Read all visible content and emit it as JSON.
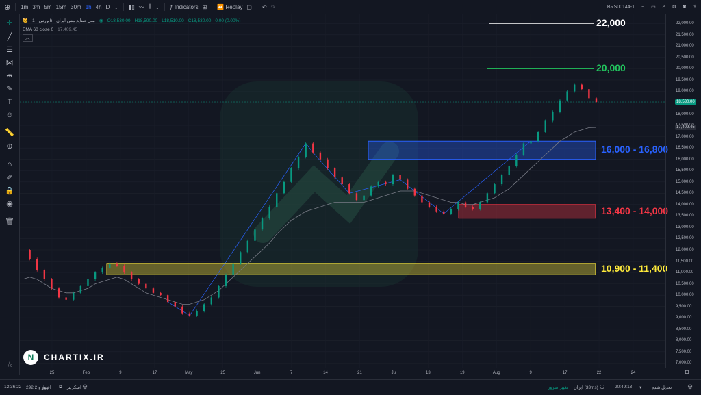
{
  "toolbar": {
    "intervals": [
      "1m",
      "3m",
      "5m",
      "15m",
      "30m",
      "1h",
      "4h",
      "D"
    ],
    "active_interval": "1h",
    "indicators_label": "Indicators",
    "replay_label": "Replay",
    "symbol": "BRS00144-1"
  },
  "legend": {
    "title": "بورس · 1h · ملی صنایع مس ایران",
    "open": "O18,530.00",
    "high": "H18,590.00",
    "low": "L18,510.00",
    "close": "C18,530.00",
    "change": "0.00 (0.00%)",
    "ema_label": "EMA 60 close 0",
    "ema_value": "17,409.45"
  },
  "price_axis": {
    "labels": [
      "22,000.00",
      "21,500.00",
      "21,000.00",
      "20,500.00",
      "20,000.00",
      "19,500.00",
      "19,000.00",
      "18,500.00",
      "18,000.00",
      "17,500.00",
      "17,000.00",
      "16,500.00",
      "16,000.00",
      "15,500.00",
      "15,000.00",
      "14,500.00",
      "14,000.00",
      "13,500.00",
      "13,000.00",
      "12,500.00",
      "12,000.00",
      "11,500.00",
      "11,000.00",
      "10,500.00",
      "10,000.00",
      "9,500.00",
      "9,000.00",
      "8,500.00",
      "8,000.00",
      "7,500.00",
      "7,000.00"
    ],
    "current_price_tag": "18,530.00",
    "ema_tag": "17,409.45"
  },
  "time_axis": {
    "labels": [
      "25",
      "Feb",
      "9",
      "17",
      "May",
      "25",
      "Jun",
      "7",
      "14",
      "21",
      "Jul",
      "13",
      "19",
      "Aug",
      "9",
      "17",
      "22",
      "24"
    ]
  },
  "chart_data": {
    "type": "candlestick",
    "ylim": [
      6800,
      22400
    ],
    "levels": [
      {
        "label": "22,000",
        "value": 22000,
        "color": "#ffffff"
      },
      {
        "label": "20,000",
        "value": 20000,
        "color": "#22c55e"
      }
    ],
    "zones": [
      {
        "label": "16,000 - 16,800",
        "low": 16000,
        "high": 16800,
        "color": "#2962ff"
      },
      {
        "label": "13,400 - 14,000",
        "low": 13400,
        "high": 14000,
        "color": "#f23645"
      },
      {
        "label": "10,900 - 11,400",
        "low": 10900,
        "high": 11400,
        "color": "#ffeb3b"
      }
    ],
    "price_path": [
      12000,
      11600,
      11100,
      10700,
      10300,
      9900,
      9800,
      10100,
      10400,
      10700,
      11000,
      11200,
      11400,
      11300,
      11000,
      10700,
      10500,
      10300,
      10100,
      10000,
      9700,
      9500,
      9200,
      9100,
      9300,
      9600,
      9900,
      10400,
      10900,
      11400,
      11900,
      12400,
      12900,
      13400,
      13900,
      14500,
      15000,
      15600,
      16100,
      16700,
      16300,
      16000,
      15600,
      15200,
      14900,
      14500,
      14200,
      14400,
      14800,
      15000,
      14900,
      15300,
      15100,
      14700,
      14400,
      14100,
      13900,
      13700,
      13600,
      13800,
      14100,
      13900,
      13800,
      14100,
      14500,
      14900,
      15300,
      15700,
      16200,
      16700,
      16800,
      17200,
      17700,
      18100,
      18600,
      19000,
      19300,
      19100,
      18700,
      18530
    ],
    "ema_path": [
      10700,
      10800,
      10700,
      10500,
      10300,
      10200,
      10100,
      10100,
      10200,
      10300,
      10500,
      10600,
      10700,
      10800,
      10700,
      10500,
      10300,
      10100,
      10000,
      9900,
      9800,
      9700,
      9600,
      9600,
      9700,
      9800,
      10000,
      10200,
      10500,
      10800,
      11100,
      11400,
      11700,
      12000,
      12300,
      12700,
      13000,
      13300,
      13500,
      13700,
      13800,
      13900,
      14000,
      14100,
      14100,
      14100,
      14100,
      14100,
      14200,
      14300,
      14400,
      14500,
      14600,
      14600,
      14600,
      14500,
      14400,
      14300,
      14200,
      14100,
      14100,
      14000,
      14000,
      14100,
      14200,
      14300,
      14500,
      14700,
      15000,
      15300,
      15600,
      15900,
      16200,
      16500,
      16800,
      17000,
      17200,
      17300,
      17400,
      17409
    ]
  },
  "branding": {
    "text": "CHARTIX.IR",
    "logo": "N"
  },
  "bottombar": {
    "time": "12:36:22",
    "days_label": "292 روز و 2",
    "credit_label": "اعتبار",
    "screener_label": "اسکرینر",
    "update_label": "تغییر سرور",
    "server_label": "ایران (33ms)",
    "clock": "20:49:13",
    "adjust_label": "تعدیل شده"
  },
  "colors": {
    "up": "#089981",
    "down": "#f23645",
    "ema": "#787b86",
    "trend": "#2962ff",
    "bg": "#131722"
  }
}
